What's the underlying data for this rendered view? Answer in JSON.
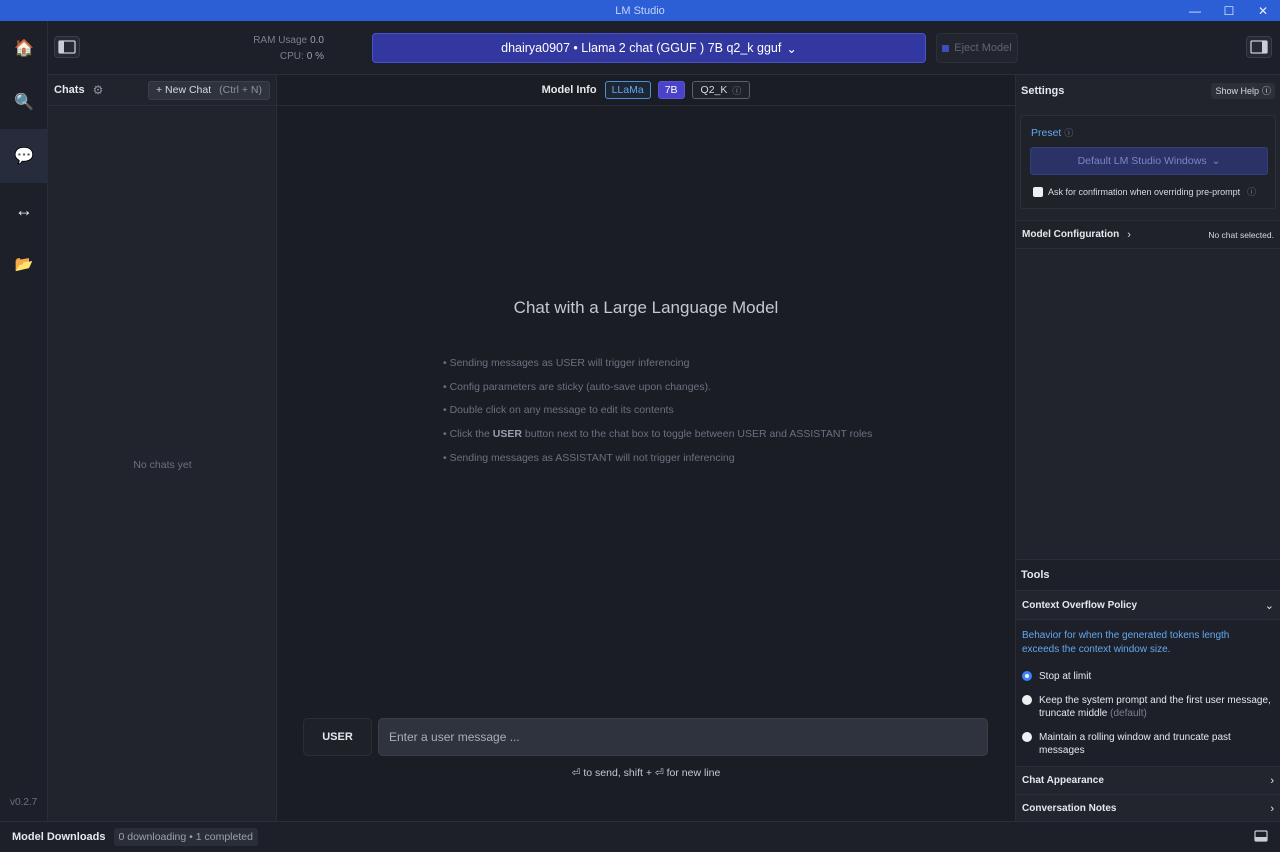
{
  "window": {
    "title": "LM Studio",
    "controls": [
      "—",
      "☐",
      "✕"
    ]
  },
  "rail": {
    "items": [
      {
        "name": "home",
        "icon": "🏠"
      },
      {
        "name": "search",
        "icon": "🔍"
      },
      {
        "name": "chat",
        "icon": "💬"
      },
      {
        "name": "local-server",
        "icon": "↔"
      },
      {
        "name": "my-models",
        "icon": "📂"
      }
    ],
    "version": "v0.2.7"
  },
  "topbar": {
    "ram_label": "RAM Usage",
    "ram_value": "0.0",
    "cpu_label": "CPU:",
    "cpu_value": "0 %",
    "model_label": "dhairya0907 • Llama 2 chat (GGUF ) 7B q2_k gguf",
    "model_chevron": "⌄",
    "eject_label": "Eject Model"
  },
  "chats": {
    "title": "Chats",
    "new_chat_label": "+ New Chat",
    "new_chat_shortcut": "(Ctrl + N)",
    "empty_text": "No chats yet"
  },
  "main": {
    "model_info_label": "Model Info",
    "tags": {
      "arch": "LLaMa",
      "size": "7B",
      "quant": "Q2_K"
    },
    "headline": "Chat with a Large Language Model",
    "tips": [
      {
        "pre": "• Sending messages as USER will trigger inferencing",
        "bold": "",
        "post": ""
      },
      {
        "pre": "• Config parameters are sticky (auto-save upon changes).",
        "bold": "",
        "post": ""
      },
      {
        "pre": "• Double click on any message to edit its contents",
        "bold": "",
        "post": ""
      },
      {
        "pre": "• Click the ",
        "bold": "USER",
        "post": " button next to the chat box to toggle between USER and ASSISTANT roles"
      },
      {
        "pre": "• Sending messages as ASSISTANT will not trigger inferencing",
        "bold": "",
        "post": ""
      }
    ],
    "role_label": "USER",
    "input_placeholder": "Enter a user message ...",
    "input_value": "",
    "hint": "⏎ to send, shift + ⏎ for new line"
  },
  "settings": {
    "title": "Settings",
    "show_help": "Show Help",
    "preset_label": "Preset",
    "preset_value": "Default LM Studio Windows",
    "confirm_label": "Ask for confirmation when overriding pre-prompt",
    "model_config_label": "Model Configuration",
    "no_chat_selected": "No chat selected.",
    "tools_title": "Tools",
    "context_overflow_label": "Context Overflow Policy",
    "context_overflow_desc": "Behavior for when the generated tokens length exceeds the context window size.",
    "options": [
      {
        "label": "Stop at limit",
        "suffix": "",
        "selected": true
      },
      {
        "label": "Keep the system prompt and the first user message, truncate middle",
        "suffix": "(default)",
        "selected": false
      },
      {
        "label": "Maintain a rolling window and truncate past messages",
        "suffix": "",
        "selected": false
      }
    ],
    "chat_appearance_label": "Chat Appearance",
    "conversation_notes_label": "Conversation Notes"
  },
  "statusbar": {
    "title": "Model Downloads",
    "status": "0 downloading • 1 completed"
  },
  "colors": {
    "titlebar": "#2c5fd6",
    "accent_blue": "#62a8f0",
    "model_button": "#3238a0",
    "tag_7b": "#4a42c9"
  }
}
